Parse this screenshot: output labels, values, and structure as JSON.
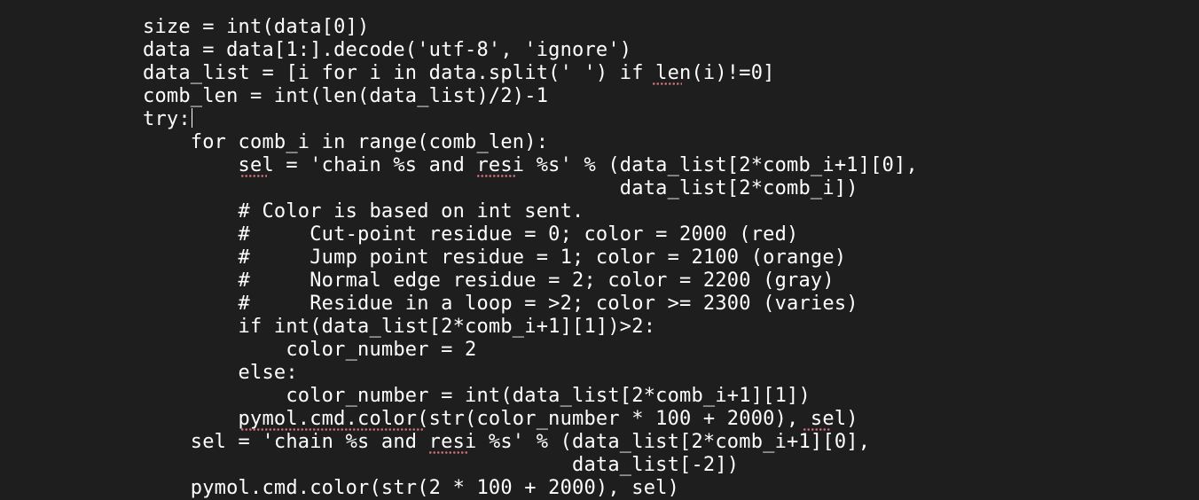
{
  "editor": {
    "lines": [
      "size = int(data[0])",
      "data = data[1:].decode('utf-8', 'ignore')",
      "data_list = [i for i in data.split(' ') if len(i)!=0]",
      "comb_len = int(len(data_list)/2)-1",
      "try:",
      "    for comb_i in range(comb_len):",
      "        sel = 'chain %s and resi %s' % (data_list[2*comb_i+1][0],",
      "                                        data_list[2*comb_i])",
      "        # Color is based on int sent.",
      "        #     Cut-point residue = 0; color = 2000 (red)",
      "        #     Jump point residue = 1; color = 2100 (orange)",
      "        #     Normal edge residue = 2; color = 2200 (gray)",
      "        #     Residue in a loop = >2; color >= 2300 (varies)",
      "        if int(data_list[2*comb_i+1][1])>2:",
      "            color_number = 2",
      "        else:",
      "            color_number = int(data_list[2*comb_i+1][1])",
      "        pymol.cmd.color(str(color_number * 100 + 2000), sel)",
      "    sel = 'chain %s and resi %s' % (data_list[2*comb_i+1][0],",
      "                                    data_list[-2])",
      "    pymol.cmd.color(str(2 * 100 + 2000), sel)"
    ],
    "squiggle_color": "#c9707a",
    "background_color": "#1e1e1e",
    "text_color": "#ffffff"
  }
}
